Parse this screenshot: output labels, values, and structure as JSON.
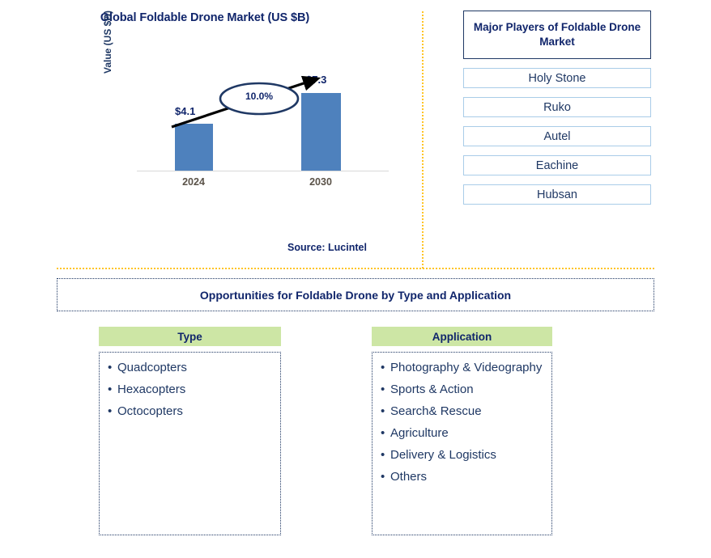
{
  "chart_data": {
    "type": "bar",
    "title": "Global Foldable Drone Market (US $B)",
    "xlabel": "",
    "ylabel": "Value (US $B)",
    "categories": [
      "2024",
      "2030"
    ],
    "values": [
      4.1,
      7.3
    ],
    "value_labels": [
      "$4.1",
      "$7.3"
    ],
    "ylim": [
      0,
      8.2
    ],
    "grid": false,
    "legend": "none",
    "bar_color": "#4E81BD",
    "annotations": [
      {
        "name": "cagr-callout",
        "text": "10.0%",
        "shape": "ellipse-with-arrow",
        "from_category": "2024",
        "to_category": "2030"
      }
    ],
    "source": "Source: Lucintel"
  },
  "chart_panel": {
    "title": "Global Foldable Drone Market (US $B)",
    "y_axis_label": "Value (US $B)",
    "tick_2024": "2024",
    "tick_2030": "2030",
    "value_2024": "$4.1",
    "value_2030": "$7.3",
    "cagr": "10.0%",
    "source": "Source: Lucintel"
  },
  "players_panel": {
    "header": "Major Players of Foldable Drone Market",
    "items": [
      {
        "label": "Holy Stone"
      },
      {
        "label": "Ruko"
      },
      {
        "label": "Autel"
      },
      {
        "label": "Eachine"
      },
      {
        "label": "Hubsan"
      }
    ]
  },
  "opportunities": {
    "banner": "Opportunities for Foldable Drone by Type and Application",
    "columns": [
      {
        "header": "Type",
        "items": [
          "Quadcopters",
          "Hexacopters",
          "Octocopters"
        ]
      },
      {
        "header": "Application",
        "items": [
          "Photography & Videography",
          "Sports & Action",
          "Search& Rescue",
          "Agriculture",
          "Delivery & Logistics",
          "Others"
        ]
      }
    ]
  },
  "colors": {
    "bar": "#4E81BD",
    "navy_text": "#10256B",
    "divider_gold": "#FFC425",
    "header_green": "#CDE6A5",
    "player_border": "#A9CCE8"
  }
}
